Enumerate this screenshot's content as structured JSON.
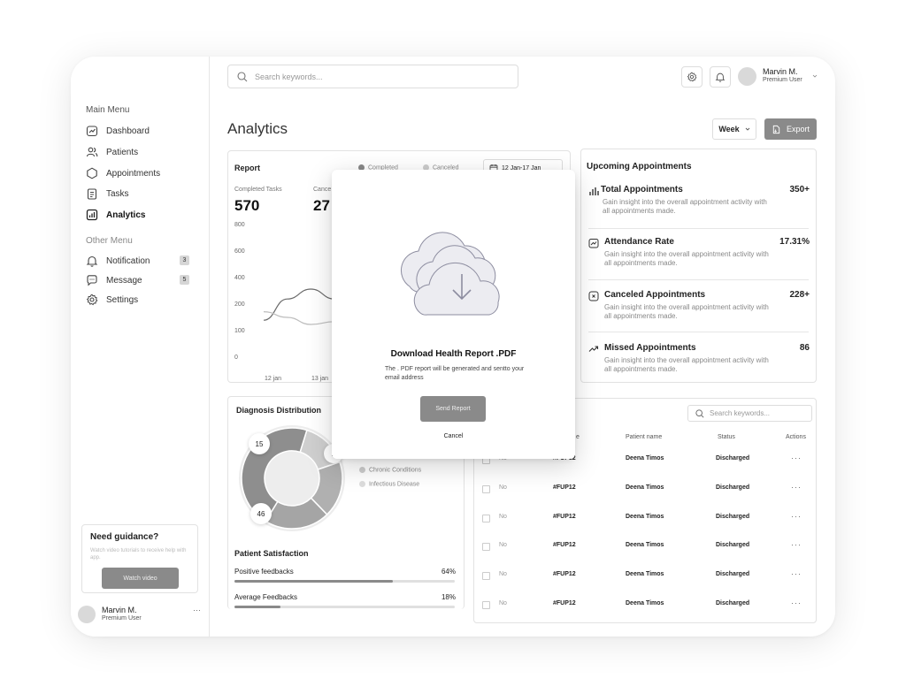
{
  "header": {
    "search_placeholder": "Search keywords...",
    "user_name": "Marvin M.",
    "user_role": "Premium User"
  },
  "sidebar": {
    "main_menu_title": "Main Menu",
    "main_items": [
      {
        "label": "Dashboard",
        "icon": "dashboard-icon"
      },
      {
        "label": "Patients",
        "icon": "users-icon"
      },
      {
        "label": "Appointments",
        "icon": "hexagon-icon"
      },
      {
        "label": "Tasks",
        "icon": "clipboard-icon"
      },
      {
        "label": "Analytics",
        "icon": "analytics-icon",
        "active": true
      }
    ],
    "other_menu_title": "Other Menu",
    "other_items": [
      {
        "label": "Notification",
        "badge": "3",
        "icon": "bell-icon"
      },
      {
        "label": "Message",
        "badge": "5",
        "icon": "message-icon"
      },
      {
        "label": "Settings",
        "icon": "gear-icon"
      }
    ],
    "guidance": {
      "title": "Need guidance?",
      "text": "Watch video tutorials to receive help with app.",
      "button": "Watch video"
    },
    "user_name": "Marvin M.",
    "user_role": "Premium User"
  },
  "page": {
    "title": "Analytics",
    "period": "Week",
    "export_label": "Export"
  },
  "report": {
    "title": "Report",
    "legend_completed": "Completed",
    "legend_canceled": "Canceled",
    "date_range": "12 Jan-17 Jan",
    "completed_label": "Completed Tasks",
    "completed_value": "570",
    "canceled_label": "Cance",
    "canceled_value": "27"
  },
  "chart_data": {
    "type": "line",
    "y_ticks": [
      "800",
      "600",
      "400",
      "200",
      "100",
      "0"
    ],
    "x_ticks": [
      "12 jan",
      "13 jan"
    ],
    "ylim": [
      0,
      800
    ],
    "series": [
      {
        "name": "Completed",
        "values": [
          180,
          330,
          400,
          330
        ]
      },
      {
        "name": "Canceled",
        "values": [
          240,
          200,
          150,
          170
        ]
      }
    ],
    "colors": {
      "completed": "#6a6a6a",
      "canceled": "#bdbdbd"
    }
  },
  "upcoming": {
    "title": "Upcoming Appointments",
    "items": [
      {
        "title": "Total Appointments",
        "value": "350+",
        "desc": "Gain insight into the overall appointment activity with all appointments made."
      },
      {
        "title": "Attendance Rate",
        "value": "17.31%",
        "desc": "Gain insight into the overall appointment activity with all appointments made."
      },
      {
        "title": "Canceled Appointments",
        "value": "228+",
        "desc": "Gain insight into the overall appointment activity with all appointments made."
      },
      {
        "title": "Missed Appointments",
        "value": "86",
        "desc": "Gain insight into the overall appointment activity with all appointments made."
      }
    ]
  },
  "diagnosis": {
    "title": "Diagnosis Distribution",
    "segments": [
      {
        "label": "15",
        "value": 15,
        "color": "#cfcfcf"
      },
      {
        "label": "2",
        "value": 18,
        "color": "#b0b0b0"
      },
      {
        "label": "",
        "value": 21,
        "color": "#a5a5a5"
      },
      {
        "label": "46",
        "value": 46,
        "color": "#8e8e8e"
      }
    ],
    "legend": [
      "Chronic Conditions",
      "Infectious Disease"
    ]
  },
  "satisfaction": {
    "title": "Patient Satisfaction",
    "rows": [
      {
        "label": "Positive feedbacks",
        "value": "64%",
        "fill": 0.72
      },
      {
        "label": "Average Feedbacks",
        "value": "18%",
        "fill": 0.21
      }
    ]
  },
  "table": {
    "search_placeholder": "Search keywords...",
    "headers": [
      "e",
      "Patient name",
      "Status",
      "Actions"
    ],
    "rows": [
      {
        "no": "No",
        "id": "#FUP12",
        "name": "Deena Timos",
        "status": "Discharged"
      },
      {
        "no": "No",
        "id": "#FUP12",
        "name": "Deena Timos",
        "status": "Discharged"
      },
      {
        "no": "No",
        "id": "#FUP12",
        "name": "Deena Timos",
        "status": "Discharged"
      },
      {
        "no": "No",
        "id": "#FUP12",
        "name": "Deena Timos",
        "status": "Discharged"
      },
      {
        "no": "No",
        "id": "#FUP12",
        "name": "Deena Timos",
        "status": "Discharged"
      },
      {
        "no": "No",
        "id": "#FUP12",
        "name": "Deena Timos",
        "status": "Discharged"
      }
    ]
  },
  "modal": {
    "title": "Download Health Report .PDF",
    "text": "The . PDF report will be generated and sentto your email address",
    "send_label": "Send Report",
    "cancel_label": "Cancel"
  }
}
